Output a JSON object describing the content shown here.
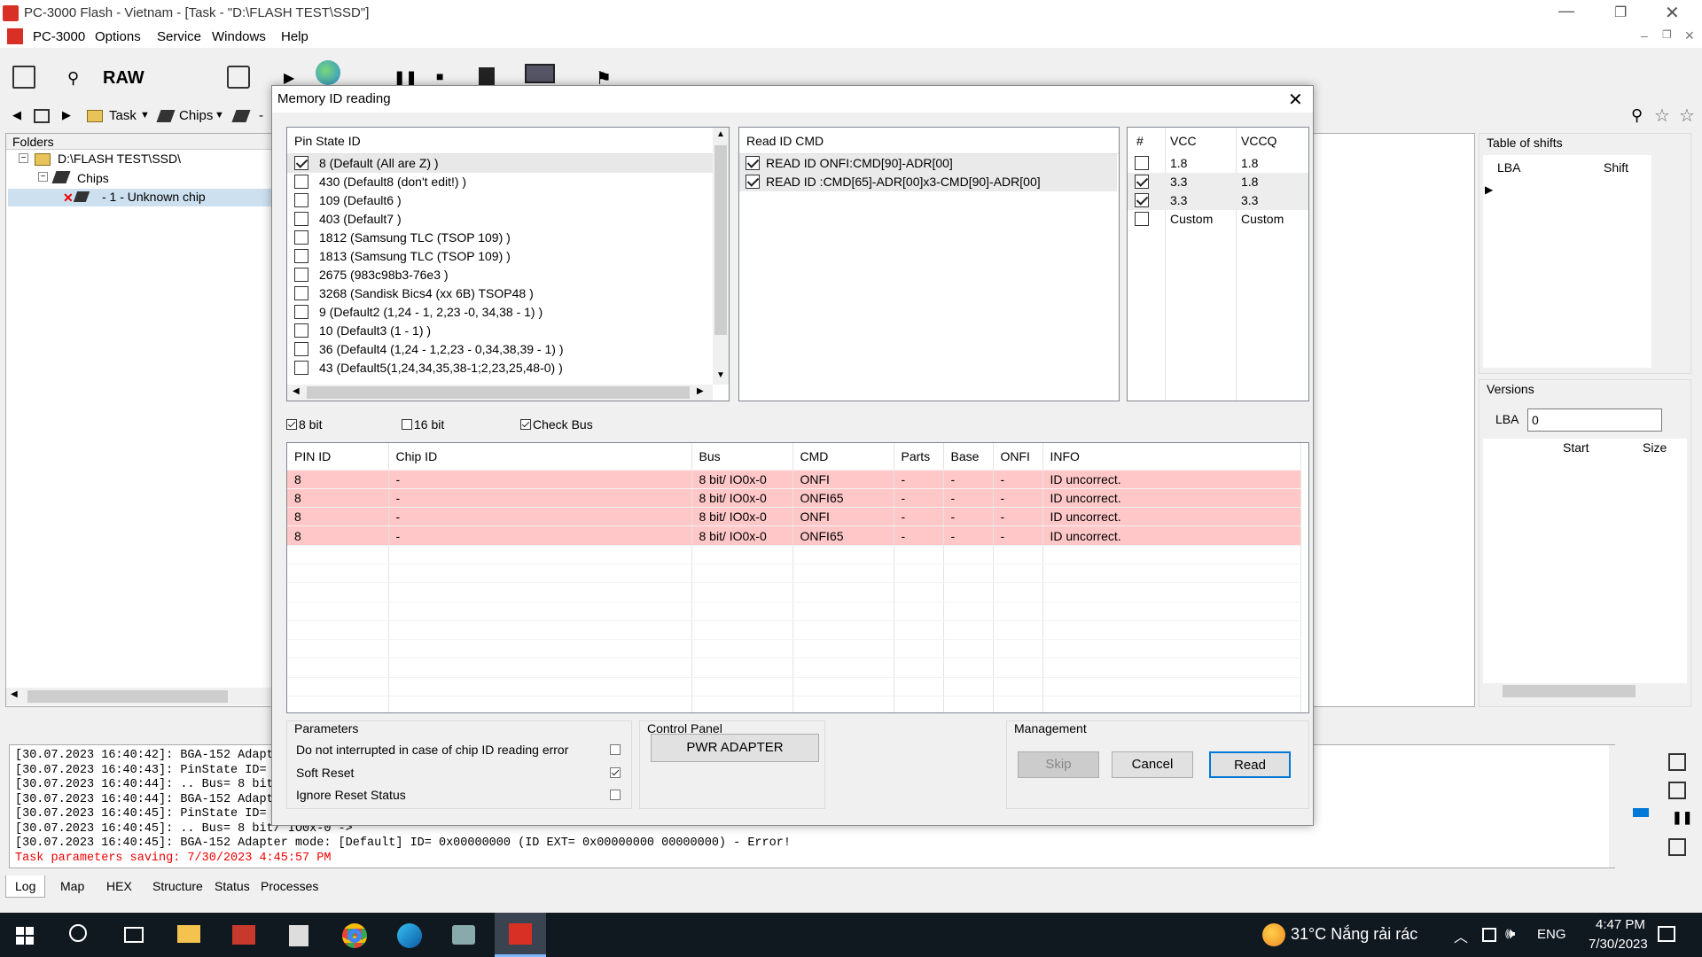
{
  "window": {
    "title": "PC-3000 Flash - Vietnam - [Task - \"D:\\FLASH TEST\\SSD\"]"
  },
  "menu": {
    "items": [
      "PC-3000",
      "Options",
      "Service",
      "Windows",
      "Help"
    ]
  },
  "toolbar": {
    "raw_label": "RAW"
  },
  "nav": {
    "task_label": "Task",
    "chips_label": "Chips",
    "dash": "-"
  },
  "folders": {
    "header": "Folders",
    "root": "D:\\FLASH TEST\\SSD\\",
    "chips": "Chips",
    "chip": "- 1 - Unknown chip"
  },
  "dialog": {
    "title": "Memory ID reading",
    "pin_state": {
      "header": "Pin State ID",
      "items": [
        {
          "label": "8 (Default (All are Z) )",
          "checked": true
        },
        {
          "label": "430 (Default8 (don't edit!) )",
          "checked": false
        },
        {
          "label": "109 (Default6 )",
          "checked": false
        },
        {
          "label": "403 (Default7 )",
          "checked": false
        },
        {
          "label": "1812 (Samsung TLC (TSOP 109) )",
          "checked": false
        },
        {
          "label": "1813 (Samsung TLC (TSOP 109) )",
          "checked": false
        },
        {
          "label": "2675 (983c98b3-76e3 )",
          "checked": false
        },
        {
          "label": "3268 (Sandisk Bics4 (xx 6B) TSOP48 )",
          "checked": false
        },
        {
          "label": "9 (Default2 (1,24 - 1, 2,23 -0, 34,38 - 1) )",
          "checked": false
        },
        {
          "label": "10 (Default3 (1 - 1) )",
          "checked": false
        },
        {
          "label": "36 (Default4 (1,24 - 1,2,23 - 0,34,38,39 - 1) )",
          "checked": false
        },
        {
          "label": "43 (Default5(1,24,34,35,38-1;2,23,25,48-0) )",
          "checked": false
        }
      ]
    },
    "read_cmd": {
      "header": "Read ID CMD",
      "items": [
        {
          "label": "READ ID ONFI:CMD[90]-ADR[00]",
          "checked": true
        },
        {
          "label": "READ ID :CMD[65]-ADR[00]x3-CMD[90]-ADR[00]",
          "checked": true
        }
      ]
    },
    "voltage": {
      "headers": [
        "#",
        "VCC",
        "VCCQ"
      ],
      "rows": [
        {
          "checked": false,
          "vcc": "1.8",
          "vccq": "1.8"
        },
        {
          "checked": true,
          "vcc": "3.3",
          "vccq": "1.8"
        },
        {
          "checked": true,
          "vcc": "3.3",
          "vccq": "3.3"
        },
        {
          "checked": false,
          "vcc": "Custom",
          "vccq": "Custom"
        }
      ]
    },
    "options": {
      "bit8": "8 bit",
      "bit8_checked": true,
      "bit16": "16 bit",
      "bit16_checked": false,
      "check_bus": "Check Bus",
      "check_bus_checked": true
    },
    "results": {
      "headers": [
        "PIN ID",
        "Chip ID",
        "Bus",
        "CMD",
        "Parts",
        "Base",
        "ONFI",
        "INFO"
      ],
      "rows": [
        [
          "8",
          "-",
          "8 bit/ IO0x-0",
          "ONFI",
          "-",
          "-",
          "-",
          "ID uncorrect."
        ],
        [
          "8",
          "-",
          "8 bit/ IO0x-0",
          "ONFI65",
          "-",
          "-",
          "-",
          "ID uncorrect."
        ],
        [
          "8",
          "-",
          "8 bit/ IO0x-0",
          "ONFI",
          "-",
          "-",
          "-",
          "ID uncorrect."
        ],
        [
          "8",
          "-",
          "8 bit/ IO0x-0",
          "ONFI65",
          "-",
          "-",
          "-",
          "ID uncorrect."
        ]
      ]
    },
    "parameters": {
      "title": "Parameters",
      "items": [
        {
          "label": "Do not interrupted in case of chip ID reading error",
          "checked": false
        },
        {
          "label": "Soft Reset",
          "checked": true
        },
        {
          "label": "Ignore Reset Status",
          "checked": false
        }
      ]
    },
    "control_panel": {
      "title": "Control Panel",
      "pwr_button": "PWR ADAPTER"
    },
    "management": {
      "title": "Management",
      "skip": "Skip",
      "cancel": "Cancel",
      "read": "Read"
    }
  },
  "right": {
    "shifts_title": "Table of shifts",
    "lba_col": "LBA",
    "shift_col": "Shift",
    "versions_title": "Versions",
    "lba_label": "LBA",
    "lba_value": "0",
    "start_col": "Start",
    "size_col": "Size"
  },
  "log": {
    "lines": [
      "[30.07.2023 16:40:42]: BGA-152 Adapt",
      "[30.07.2023 16:40:43]: PinState ID=",
      "[30.07.2023 16:40:44]: .. Bus= 8 bit",
      "[30.07.2023 16:40:44]: BGA-152 Adapt",
      "[30.07.2023 16:40:45]: PinState ID=",
      "[30.07.2023 16:40:45]: .. Bus= 8 bit/ IO0x-0 ->",
      "[30.07.2023 16:40:45]: BGA-152 Adapter mode: [Default] ID= 0x00000000  (ID EXT= 0x00000000 00000000) - Error!"
    ],
    "red_line": "Task parameters saving: 7/30/2023 4:45:57 PM"
  },
  "bottom_tabs": [
    "Log",
    "Map",
    "HEX",
    "Structure",
    "Status",
    "Processes"
  ],
  "taskbar": {
    "weather": "31°C  Nắng rải rác",
    "lang": "ENG",
    "time": "4:47 PM",
    "date": "7/30/2023"
  },
  "colors": {
    "error_row": "#ffc7c7",
    "accent": "#0078d7"
  }
}
